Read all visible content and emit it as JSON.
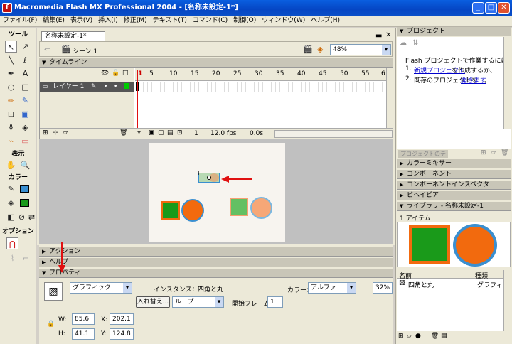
{
  "window": {
    "title": "Macromedia Flash MX Professional 2004 - [名称未設定-1*]"
  },
  "menu": [
    "ファイル(F)",
    "編集(E)",
    "表示(V)",
    "挿入(I)",
    "修正(M)",
    "テキスト(T)",
    "コマンド(C)",
    "制御(O)",
    "ウィンドウ(W)",
    "ヘルプ(H)"
  ],
  "tools": {
    "title": "ツール",
    "view_label": "表示",
    "color_label": "カラー",
    "options_label": "オプション"
  },
  "document": {
    "tab": "名称未設定-1*",
    "scene": "シーン 1",
    "zoom": "48%"
  },
  "timeline": {
    "title": "タイムライン",
    "layer_name": "レイヤー 1",
    "frame_numbers": [
      "1",
      "5",
      "10",
      "15",
      "20",
      "25",
      "30",
      "35",
      "40",
      "45",
      "50",
      "55",
      "6"
    ],
    "current_frame": "1",
    "fps": "12.0 fps",
    "time": "0.0s"
  },
  "panels": {
    "actions": "アクション",
    "help": "ヘルプ",
    "properties": "プロパティ"
  },
  "properties": {
    "symbol_type": "グラフィック",
    "instance_label": "インスタンス：",
    "instance_name": "四角と丸",
    "swap_button": "入れ替え...",
    "loop": "ループ",
    "first_frame_label": "開始フレーム：",
    "first_frame": "1",
    "color_label": "カラー：",
    "color_mode": "アルファ",
    "alpha": "32%",
    "w_label": "W:",
    "w": "85.6",
    "h_label": "H:",
    "h": "41.1",
    "x_label": "X:",
    "x": "202.1",
    "y_label": "Y:",
    "y": "124.8"
  },
  "right": {
    "project_title": "プロジェクト",
    "project_text": "Flash プロジェクトで作業するには：",
    "step1_num": "1.",
    "step1_link": "新規プロジェクト",
    "step1_rest": "を作成するか、",
    "step2_num": "2.",
    "step2_pre": "既存のプロジェクトを",
    "step2_link": "開きます",
    "step2_post": "。",
    "test_project": "プロジェクトのテスト",
    "color_mixer": "カラーミキサー",
    "components": "コンポーネント",
    "component_inspector": "コンポーネントインスペクタ",
    "behaviors": "ビヘイビア",
    "library_title": "ライブラリ - 名称未設定-1",
    "item_count": "1 アイテム",
    "col_name": "名前",
    "col_type": "種類",
    "item_name": "四角と丸",
    "item_type": "グラフィック"
  },
  "colors": {
    "green": "#1a9a1a",
    "orange": "#f26a0e",
    "blue_stroke": "#3a8fd0",
    "red_arrow": "#e01010"
  }
}
